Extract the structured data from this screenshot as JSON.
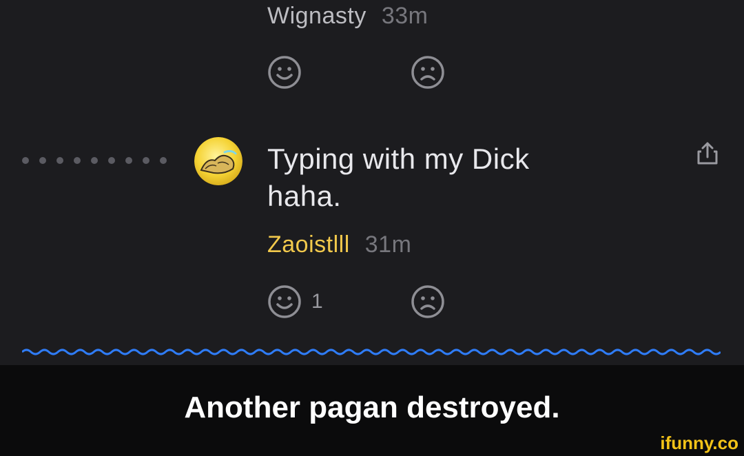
{
  "previous_comment": {
    "author": "Wignasty",
    "time": "33m"
  },
  "comment": {
    "text_line1": "Typing with my Dick",
    "text_line2": "haha.",
    "author": "Zaoistlll",
    "time": "31m",
    "upvote_count": "1"
  },
  "caption": "Another pagan destroyed.",
  "watermark": "ifunny.co",
  "colors": {
    "background": "#1c1c1f",
    "author_accent": "#f2c94c",
    "thread_wave": "#2f7cf6",
    "caption_bar": "#0b0b0c"
  },
  "icons": [
    "smile-icon",
    "frown-icon",
    "share-icon",
    "thread-dots"
  ]
}
